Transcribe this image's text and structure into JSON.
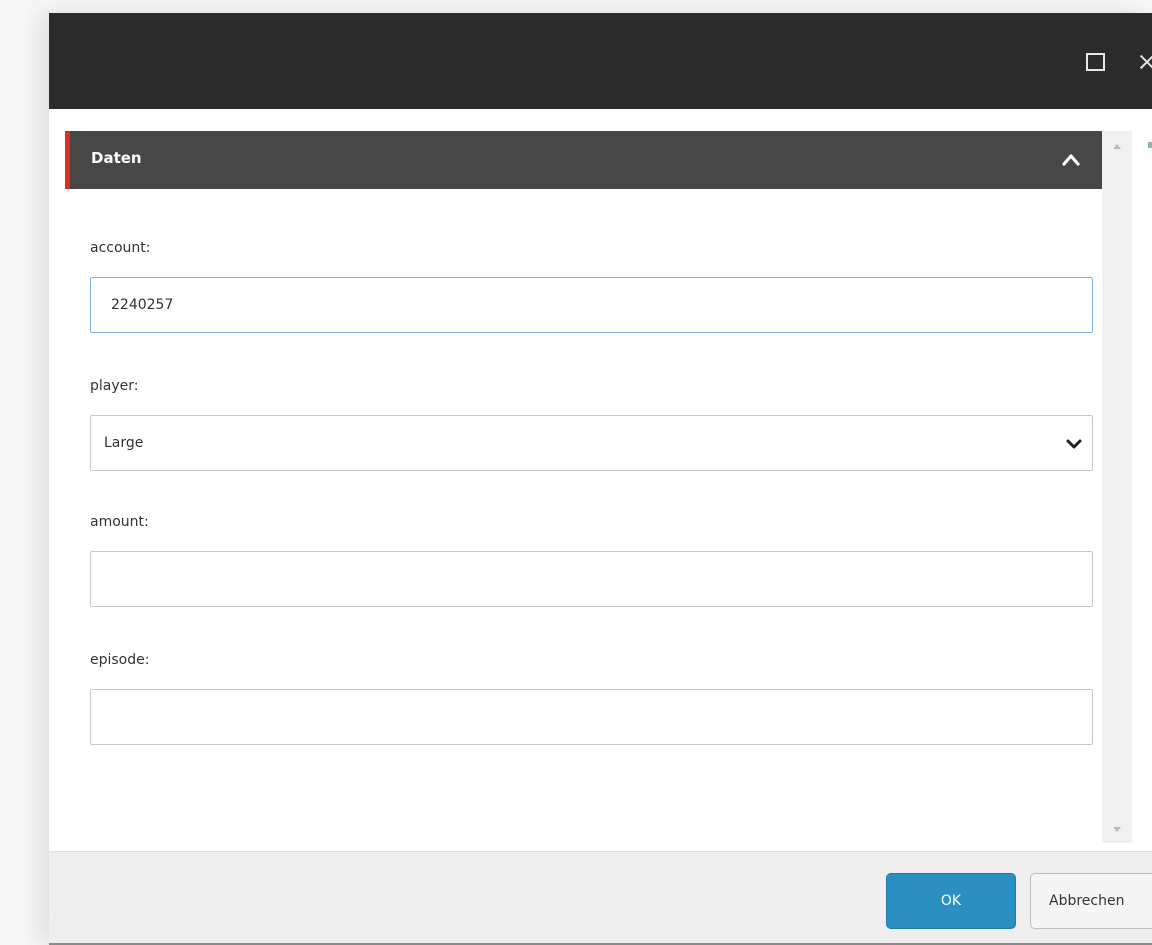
{
  "section": {
    "title": "Daten"
  },
  "fields": {
    "account": {
      "label": "account:",
      "value": "2240257"
    },
    "player": {
      "label": "player:",
      "value": "Large"
    },
    "amount": {
      "label": "amount:",
      "value": ""
    },
    "episode": {
      "label": "episode:",
      "value": ""
    }
  },
  "buttons": {
    "ok": "OK",
    "cancel": "Abbrechen"
  },
  "icons": {
    "maximize": "maximize-icon",
    "close": "close-icon",
    "collapse": "chevron-up-icon",
    "dropdown": "chevron-down-icon",
    "scroll_up": "triangle-up-icon",
    "scroll_down": "triangle-down-icon"
  },
  "colors": {
    "titlebar": "#2b2b2b",
    "section_header": "#474747",
    "section_accent": "#dc2f20",
    "primary_button": "#2b8fc2",
    "focus_border": "#7fb3e3"
  }
}
